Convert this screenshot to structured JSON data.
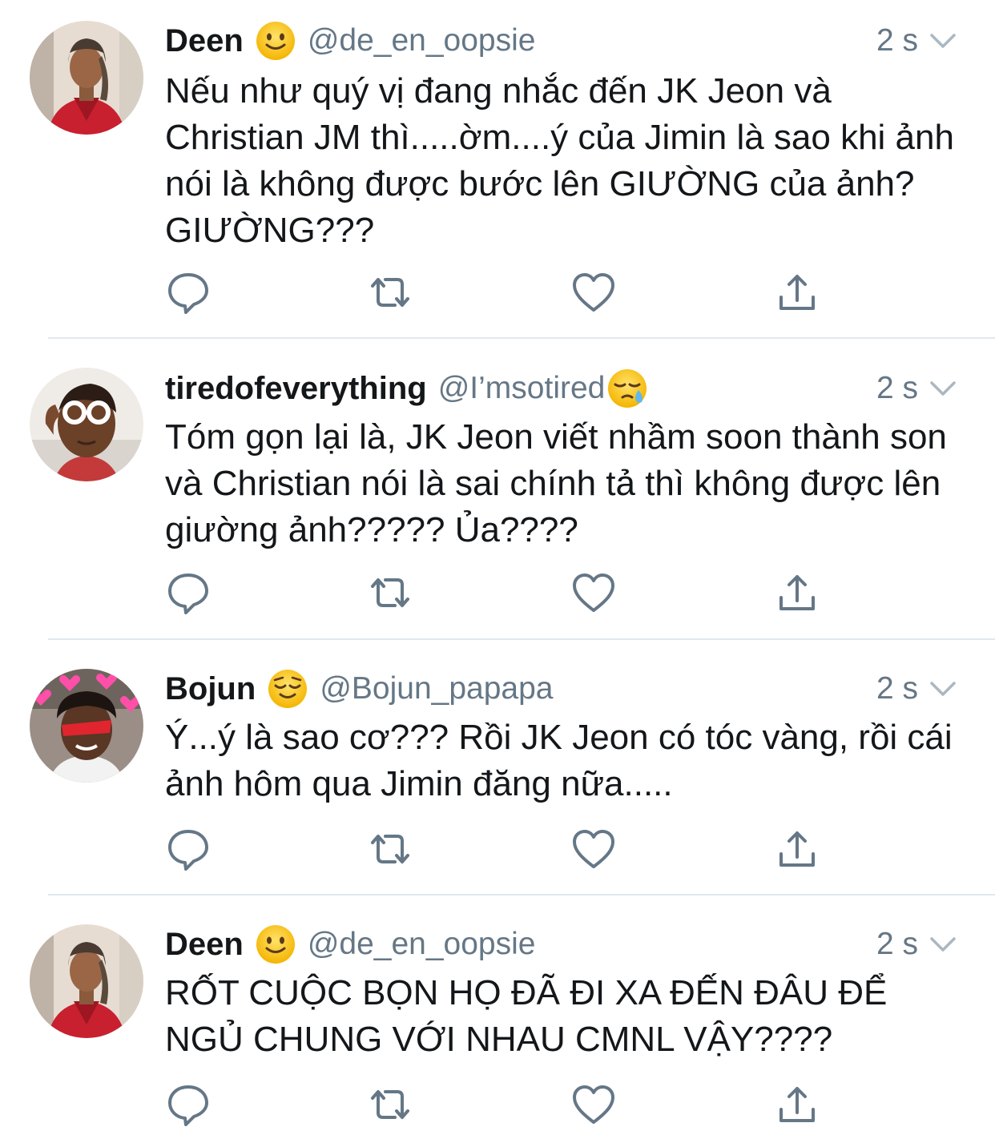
{
  "colors": {
    "primary_text": "#14171a",
    "secondary_text": "#657786",
    "action_icon": "#657786",
    "divider": "#e1e8ed"
  },
  "tweets": [
    {
      "name": "Deen",
      "handle": "@de_en_oopsie",
      "time": "2 s",
      "emoji": "slightly-smiling-face",
      "text": "Nếu như quý vị đang nhắc đến JK Jeon và Christian JM thì.....ờm....ý của Jimin là sao khi ảnh nói là không được bước lên GIƯỜNG của ảnh? GIƯỜNG???"
    },
    {
      "name": "tiredofeverything",
      "handle": "@I’msotired",
      "time": "2 s",
      "emoji": "sleepy-face",
      "text": "Tóm gọn lại là, JK Jeon viết nhầm soon thành son và Christian nói là sai chính tả thì không được lên giường ảnh????? Ủa????"
    },
    {
      "name": "Bojun",
      "handle": "@Bojun_papapa",
      "time": "2 s",
      "emoji": "relieved-face",
      "text": "Ý...ý là sao cơ??? Rồi JK Jeon có tóc vàng, rồi cái ảnh hôm qua Jimin đăng nữa....."
    },
    {
      "name": "Deen",
      "handle": "@de_en_oopsie",
      "time": "2 s",
      "emoji": "slightly-smiling-face",
      "text": "RỐT CUỘC BỌN HỌ ĐÃ ĐI XA ĐẾN ĐÂU ĐỂ NGỦ CHUNG VỚI NHAU CMNL VẬY????"
    }
  ]
}
